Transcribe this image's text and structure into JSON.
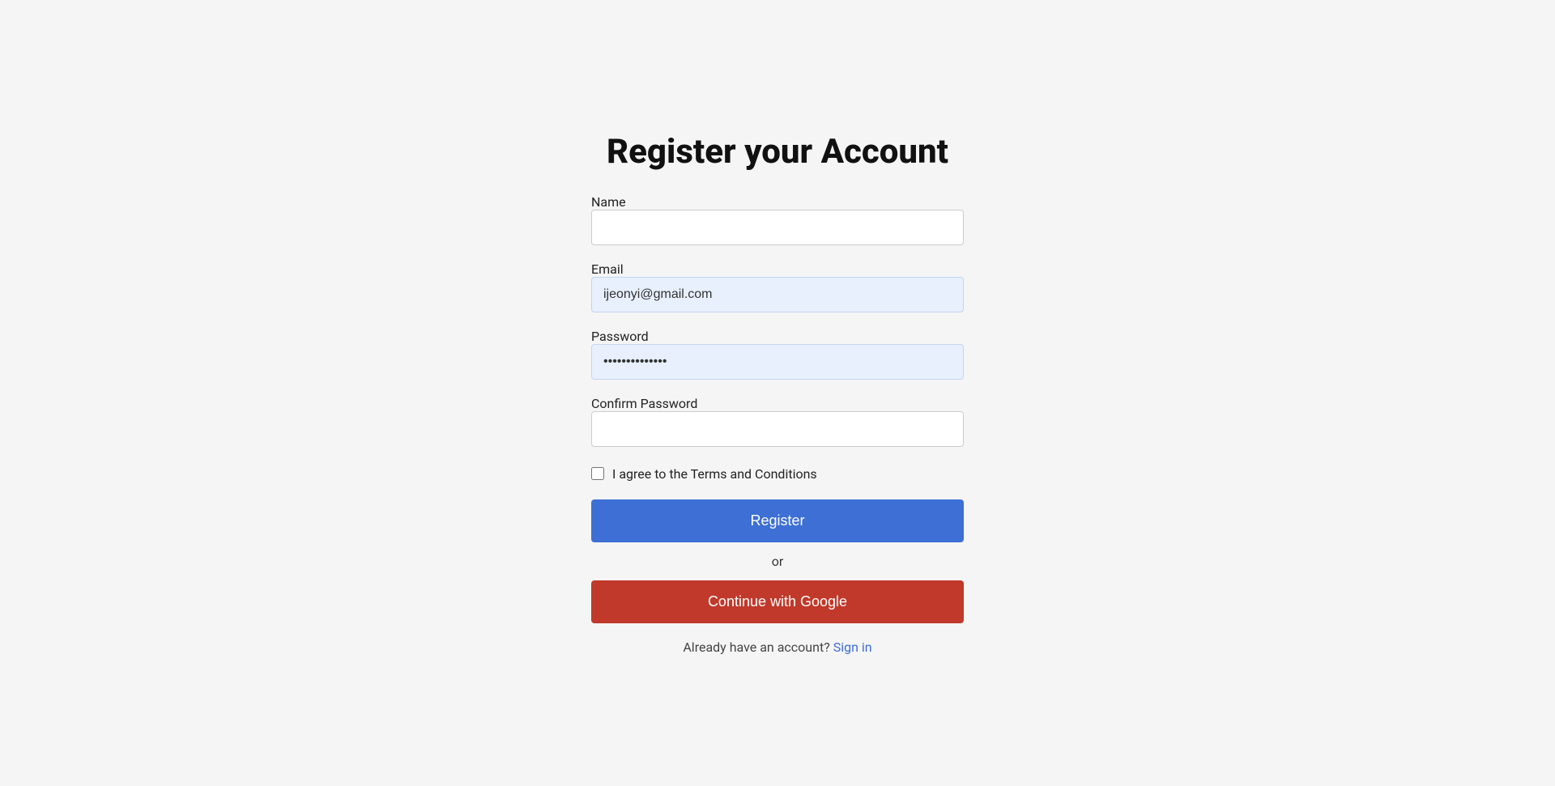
{
  "page": {
    "title": "Register your Account",
    "fields": {
      "name": {
        "label": "Name",
        "value": "",
        "placeholder": ""
      },
      "email": {
        "label": "Email",
        "value": "ijeonyi@gmail.com",
        "placeholder": ""
      },
      "password": {
        "label": "Password",
        "value": "••••••••••••••",
        "placeholder": ""
      },
      "confirm_password": {
        "label": "Confirm Password",
        "value": "",
        "placeholder": ""
      }
    },
    "checkbox": {
      "label": "I agree to the Terms and Conditions"
    },
    "buttons": {
      "register": "Register",
      "or": "or",
      "google": "Continue with Google"
    },
    "signin": {
      "text": "Already have an account?",
      "link": "Sign in"
    }
  }
}
